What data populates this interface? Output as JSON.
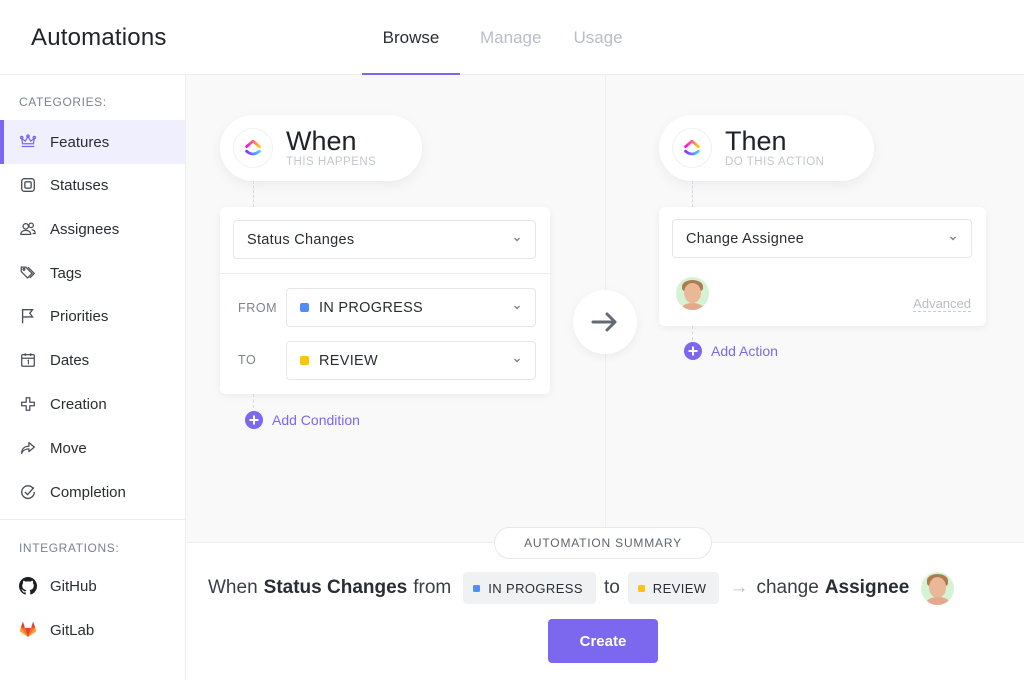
{
  "header": {
    "title": "Automations",
    "tabs": [
      {
        "label": "Browse",
        "active": true
      },
      {
        "label": "Manage",
        "active": false
      },
      {
        "label": "Usage",
        "active": false
      }
    ]
  },
  "sidebar": {
    "categories_label": "CATEGORIES:",
    "categories": [
      {
        "label": "Features",
        "icon": "crown-icon",
        "active": true
      },
      {
        "label": "Statuses",
        "icon": "status-square-icon"
      },
      {
        "label": "Assignees",
        "icon": "users-icon"
      },
      {
        "label": "Tags",
        "icon": "tags-icon"
      },
      {
        "label": "Priorities",
        "icon": "flag-icon"
      },
      {
        "label": "Dates",
        "icon": "calendar-icon"
      },
      {
        "label": "Creation",
        "icon": "plus-outline-icon"
      },
      {
        "label": "Move",
        "icon": "share-arrow-icon"
      },
      {
        "label": "Completion",
        "icon": "check-circle-icon"
      }
    ],
    "integrations_label": "INTEGRATIONS:",
    "integrations": [
      {
        "label": "GitHub",
        "icon": "github-icon"
      },
      {
        "label": "GitLab",
        "icon": "gitlab-icon"
      }
    ]
  },
  "when": {
    "title": "When",
    "subtitle": "THIS HAPPENS",
    "trigger": "Status Changes",
    "from_label": "FROM",
    "from_value": "IN PROGRESS",
    "to_label": "TO",
    "to_value": "REVIEW",
    "add_condition": "Add Condition"
  },
  "then": {
    "title": "Then",
    "subtitle": "DO THIS ACTION",
    "action": "Change Assignee",
    "advanced": "Advanced",
    "add_action": "Add Action"
  },
  "summary": {
    "badge": "AUTOMATION SUMMARY",
    "when_word": "When",
    "trigger": "Status Changes",
    "from_word": "from",
    "from_status": "IN PROGRESS",
    "to_word": "to",
    "to_status": "REVIEW",
    "arrow": "→",
    "change_word": "change",
    "field": "Assignee",
    "create_label": "Create"
  },
  "colors": {
    "accent": "#7b68ee",
    "in_progress": "#4f8ef7",
    "review": "#f9c512",
    "sidebar_active_bg": "#f0effd",
    "canvas_bg": "#f9f9fa"
  }
}
